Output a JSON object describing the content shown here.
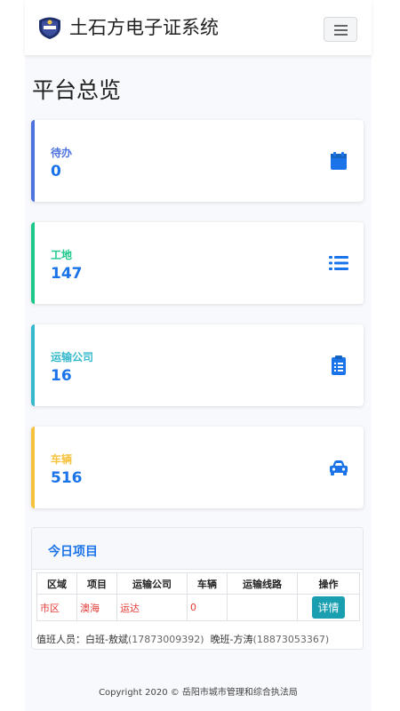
{
  "app": {
    "title": "土石方电子证系统"
  },
  "page": {
    "title": "平台总览"
  },
  "stats": [
    {
      "label": "待办",
      "value": "0",
      "color": "#4e73df",
      "icon": "calendar-icon"
    },
    {
      "label": "工地",
      "value": "147",
      "color": "#1cc88a",
      "icon": "list-icon"
    },
    {
      "label": "运输公司",
      "value": "16",
      "color": "#36b9cc",
      "icon": "clipboard-icon"
    },
    {
      "label": "车辆",
      "value": "516",
      "color": "#f6c23e",
      "icon": "car-icon"
    }
  ],
  "today": {
    "title": "今日项目",
    "headers": [
      "区域",
      "项目",
      "运输公司",
      "车辆",
      "运输线路",
      "操作"
    ],
    "rows": [
      {
        "area": "市区",
        "project": "澳海",
        "company": "运达",
        "vehicles": "0",
        "route": "",
        "action": "详情"
      }
    ],
    "duty_label": "值班人员：",
    "duty_day": "白班-敖斌",
    "duty_day_phone": "(17873009392)",
    "duty_night": "晚班-方涛",
    "duty_night_phone": "(18873053367)"
  },
  "footer": {
    "text": "Copyright 2020 © 岳阳市城市管理和综合执法局"
  }
}
